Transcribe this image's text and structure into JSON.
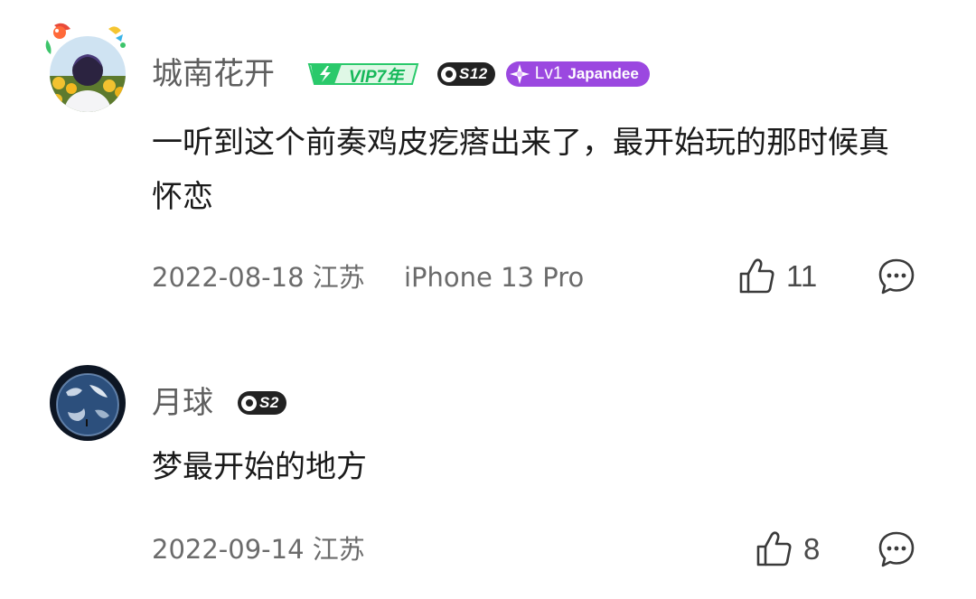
{
  "comments": [
    {
      "username": "城南花开",
      "vip_label": "VIP7年",
      "season_badge": "S12",
      "level_label": "Lv1",
      "level_name": "Japandee",
      "text": "一听到这个前奏鸡皮疙瘩出来了，最开始玩的那时候真怀恋",
      "date": "2022-08-18",
      "location": "江苏",
      "device": "iPhone 13 Pro",
      "likes": "11",
      "avatar_icon": "user-avatar-sunflower",
      "like_icon": "thumbs-up-icon",
      "reply_icon": "comment-bubble-icon"
    },
    {
      "username": "月球",
      "season_badge": "S2",
      "text": "梦最开始的地方",
      "date": "2022-09-14",
      "location": "江苏",
      "likes": "8",
      "avatar_icon": "user-avatar-earth",
      "like_icon": "thumbs-up-icon",
      "reply_icon": "comment-bubble-icon"
    }
  ],
  "colors": {
    "vip_green": "#16b85a",
    "level_purple": "#9b48e0",
    "season_dark": "#222222",
    "username_gray": "#5e5e5e",
    "meta_gray": "#6b6b6b"
  }
}
